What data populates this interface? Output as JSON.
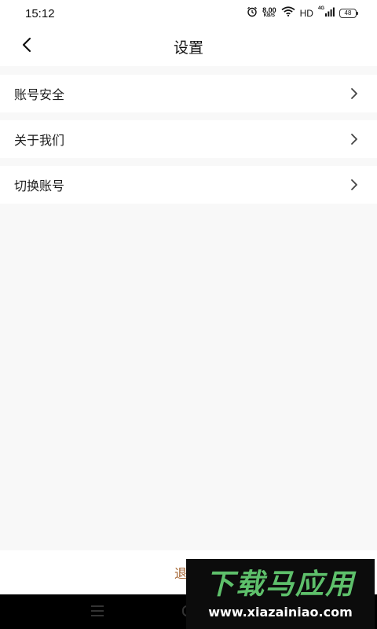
{
  "status_bar": {
    "time": "15:12",
    "net_speed_value": "8.00",
    "net_speed_unit": "KB/S",
    "hd_label": "HD",
    "signal_label": "4G",
    "battery_level": "48"
  },
  "header": {
    "title": "设置"
  },
  "settings": {
    "items": [
      {
        "label": "账号安全"
      },
      {
        "label": "关于我们"
      },
      {
        "label": "切换账号"
      }
    ]
  },
  "logout": {
    "label": "退出"
  },
  "watermark": {
    "title": "下载马应用",
    "url": "www.xiazainiao.com"
  },
  "colors": {
    "accent": "#a3622f",
    "page_bg": "#f8f8f8",
    "watermark_green": "#5ec06b"
  }
}
